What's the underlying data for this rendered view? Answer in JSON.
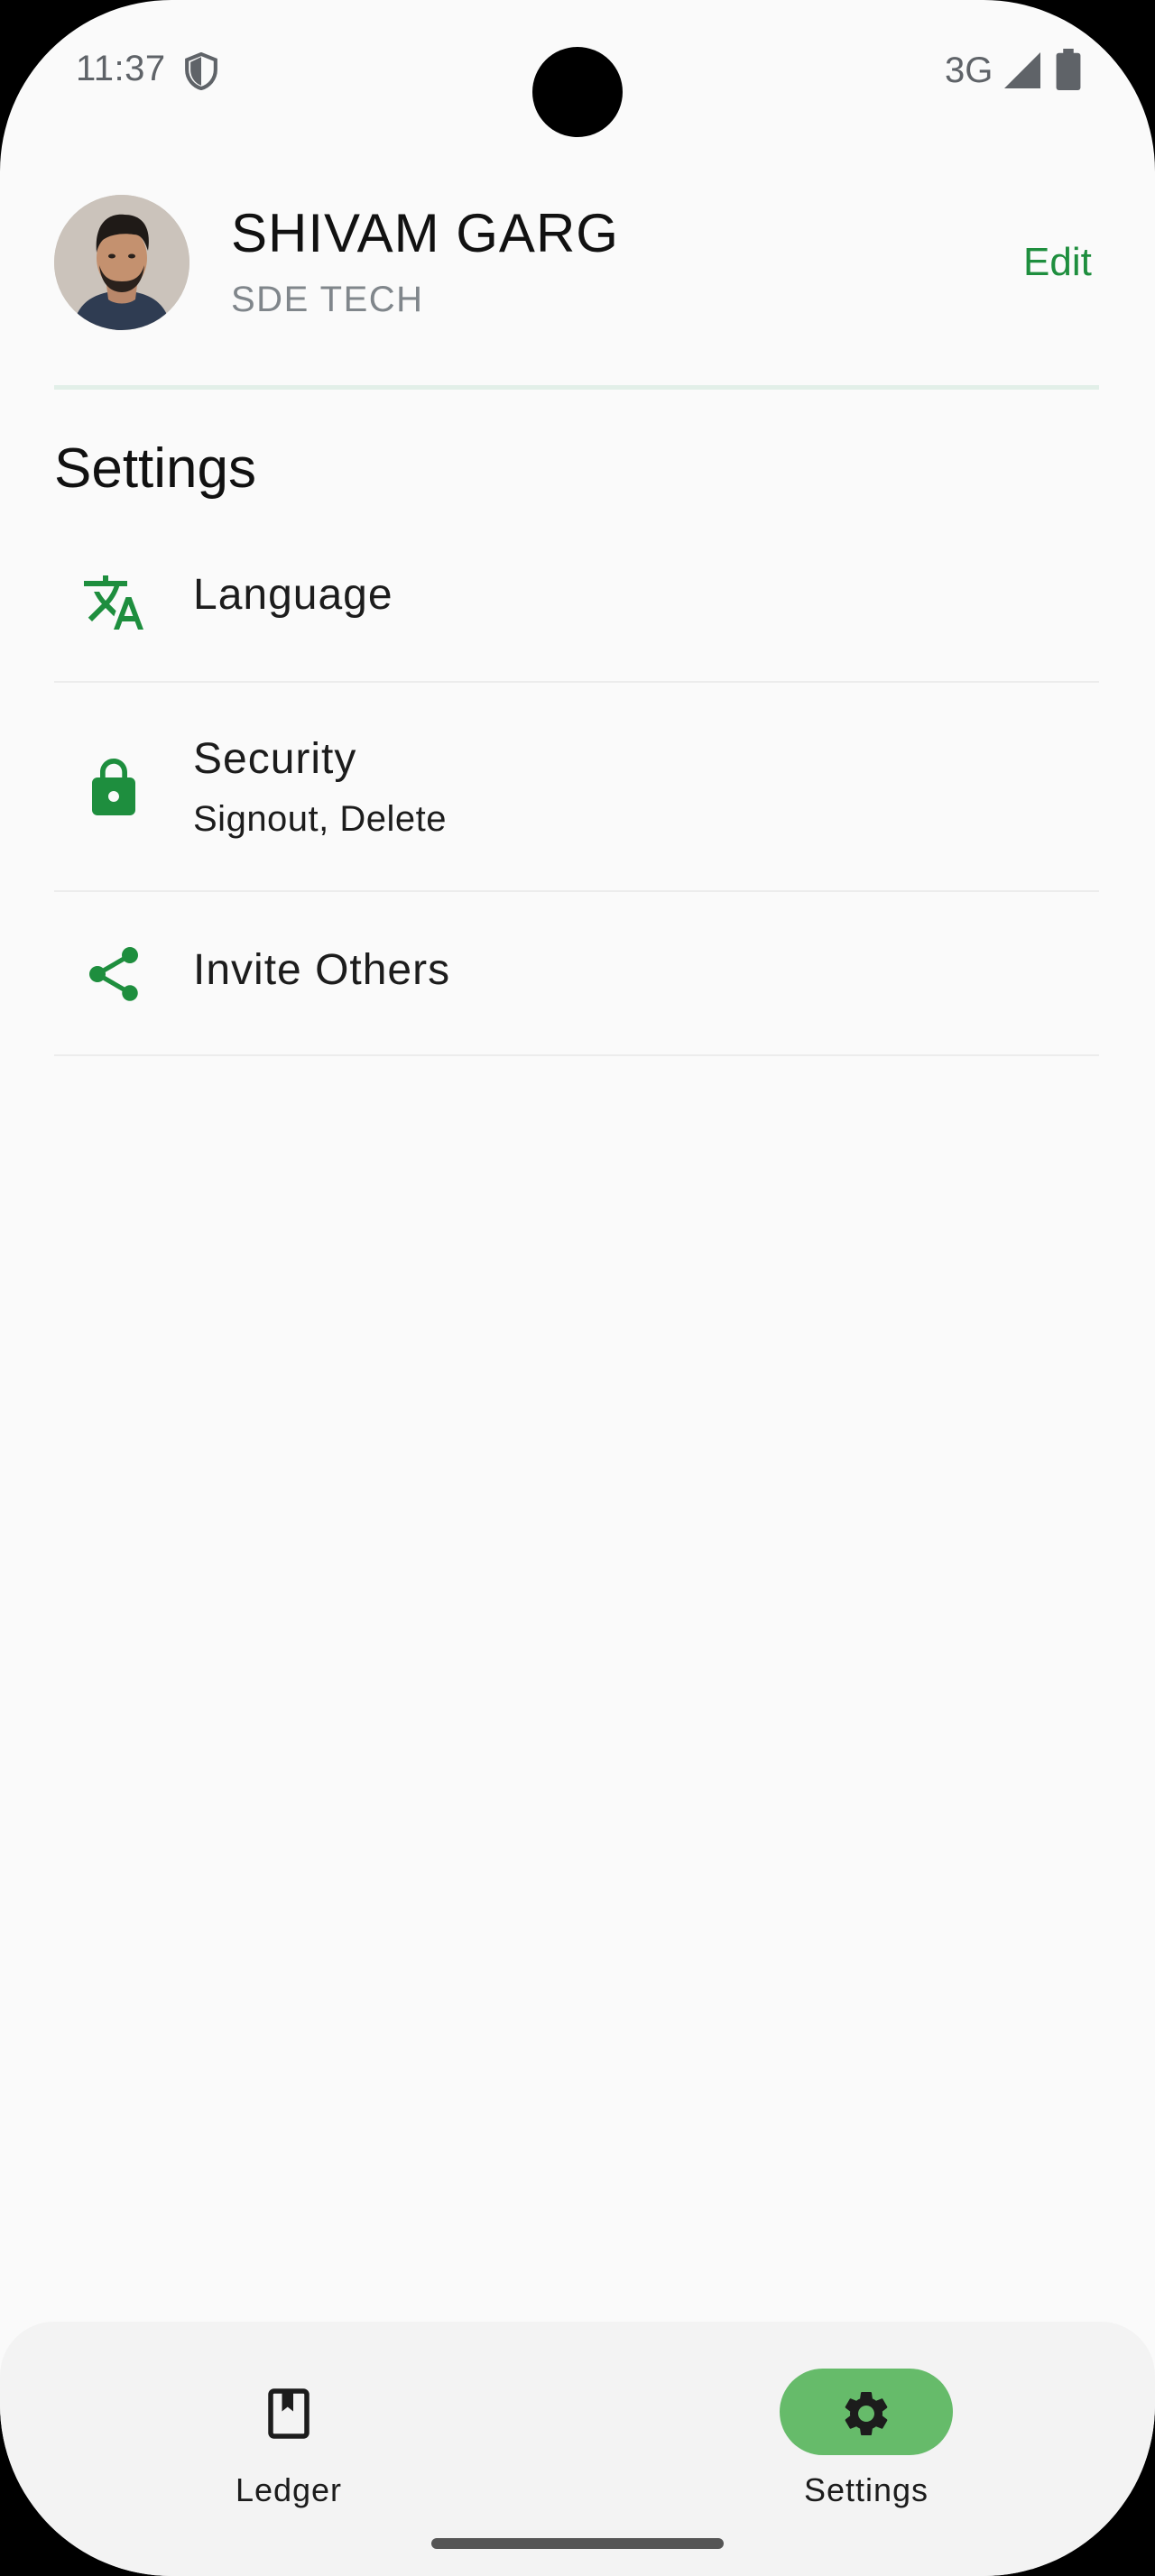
{
  "status_bar": {
    "time": "11:37",
    "network": "3G"
  },
  "profile": {
    "name": "SHIVAM GARG",
    "role": "SDE TECH",
    "edit_label": "Edit"
  },
  "settings": {
    "title": "Settings",
    "items": [
      {
        "label": "Language",
        "subtitle": "",
        "icon": "translate-icon"
      },
      {
        "label": "Security",
        "subtitle": "Signout, Delete",
        "icon": "lock-icon"
      },
      {
        "label": "Invite Others",
        "subtitle": "",
        "icon": "share-icon"
      }
    ]
  },
  "bottom_nav": {
    "items": [
      {
        "label": "Ledger",
        "icon": "book-icon",
        "active": false
      },
      {
        "label": "Settings",
        "icon": "gear-icon",
        "active": true
      }
    ]
  },
  "colors": {
    "accent": "#1e8e3e",
    "active_pill": "#66bb6a",
    "background": "#fafafa"
  }
}
